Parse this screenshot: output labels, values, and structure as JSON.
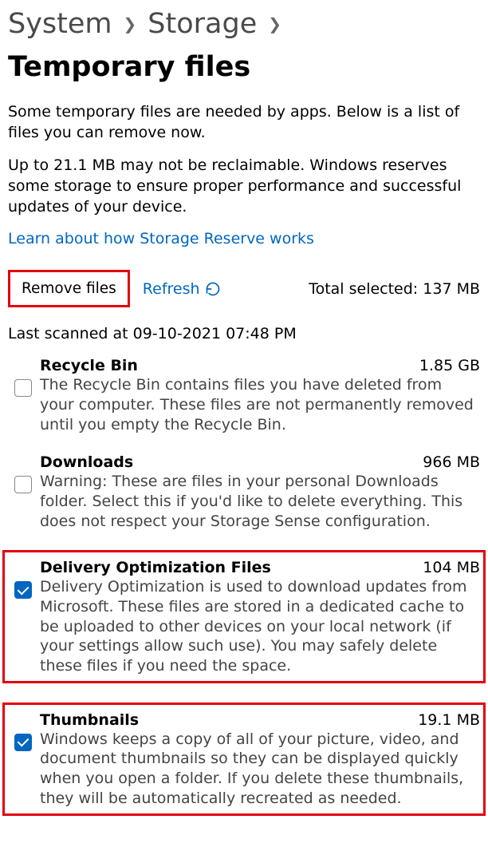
{
  "breadcrumb": {
    "system": "System",
    "storage": "Storage",
    "current": "Temporary files"
  },
  "intro": {
    "line1": "Some temporary files are needed by apps. Below is a list of files you can remove now.",
    "line2": "Up to 21.1 MB may not be reclaimable. Windows reserves some storage to ensure proper performance and successful updates of your device.",
    "link": "Learn about how Storage Reserve works"
  },
  "actions": {
    "remove_label": "Remove files",
    "refresh_label": "Refresh",
    "total_selected_label": "Total selected:",
    "total_selected_value": "137 MB"
  },
  "last_scanned": "Last scanned at 09-10-2021 07:48 PM",
  "items": [
    {
      "title": "Recycle Bin",
      "size": "1.85 GB",
      "desc": "The Recycle Bin contains files you have deleted from your computer. These files are not permanently removed until you empty the Recycle Bin.",
      "checked": false,
      "highlighted": false
    },
    {
      "title": "Downloads",
      "size": "966 MB",
      "desc": "Warning: These are files in your personal Downloads folder. Select this if you'd like to delete everything. This does not respect your Storage Sense configuration.",
      "checked": false,
      "highlighted": false
    },
    {
      "title": "Delivery Optimization Files",
      "size": "104 MB",
      "desc": "Delivery Optimization is used to download updates from Microsoft. These files are stored in a dedicated cache to be uploaded to other devices on your local network (if your settings allow such use). You may safely delete these files if you need the space.",
      "checked": true,
      "highlighted": true
    },
    {
      "title": "Thumbnails",
      "size": "19.1 MB",
      "desc": "Windows keeps a copy of all of your picture, video, and document thumbnails so they can be displayed quickly when you open a folder. If you delete these thumbnails, they will be automatically recreated as needed.",
      "checked": true,
      "highlighted": true
    }
  ]
}
